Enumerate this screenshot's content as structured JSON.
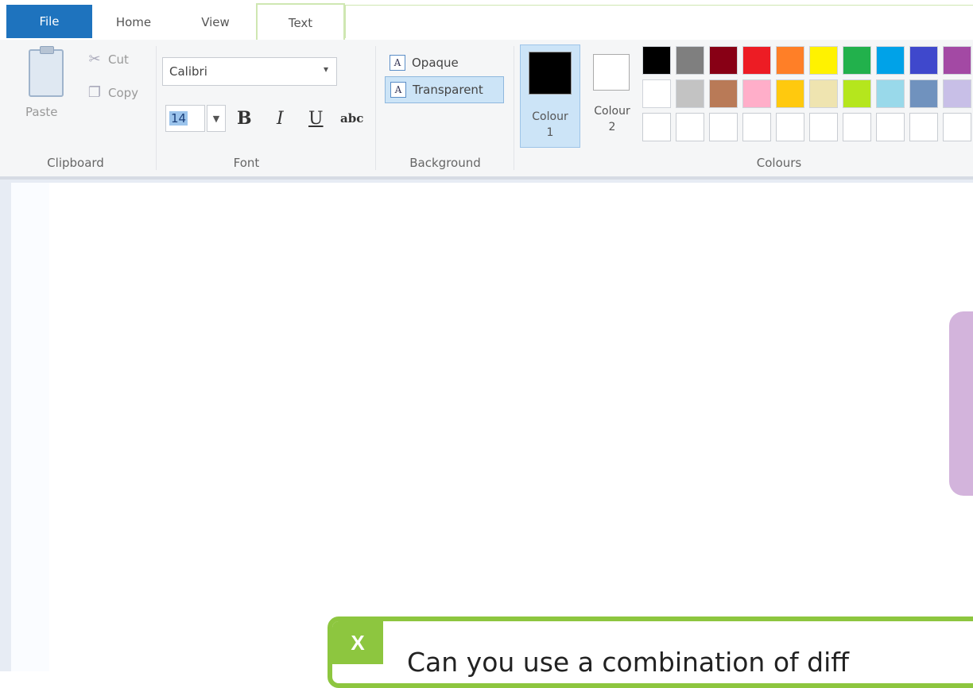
{
  "tabs": {
    "file": "File",
    "home": "Home",
    "view": "View",
    "text": "Text"
  },
  "clipboard": {
    "paste": "Paste",
    "cut": "Cut",
    "copy": "Copy",
    "group": "Clipboard"
  },
  "font": {
    "family": "Calibri",
    "size": "14",
    "bold": "B",
    "italic": "I",
    "underline": "U",
    "strikethrough": "abc",
    "group": "Font"
  },
  "background": {
    "opaque": "Opaque",
    "transparent": "Transparent",
    "group": "Background"
  },
  "colours": {
    "colour1_label": "Colour",
    "colour1_num": "1",
    "colour2_label": "Colour",
    "colour2_num": "2",
    "group": "Colours",
    "colour1_value": "#000000",
    "colour2_value": "#ffffff",
    "row1": [
      "#000000",
      "#7f7f7f",
      "#880015",
      "#ed1c24",
      "#ff7f27",
      "#fff200",
      "#22b14c",
      "#00a2e8",
      "#3f48cc",
      "#a349a4"
    ],
    "row2": [
      "#ffffff",
      "#c3c3c3",
      "#b97a57",
      "#ffaec9",
      "#ffc90e",
      "#efe4b0",
      "#b5e61d",
      "#99d9ea",
      "#7092be",
      "#c8bfe7"
    ],
    "row3": [
      "",
      "",
      "",
      "",
      "",
      "",
      "",
      "",
      "",
      ""
    ]
  },
  "question": {
    "badge": "X",
    "text": "Can you use a combination of diff"
  }
}
